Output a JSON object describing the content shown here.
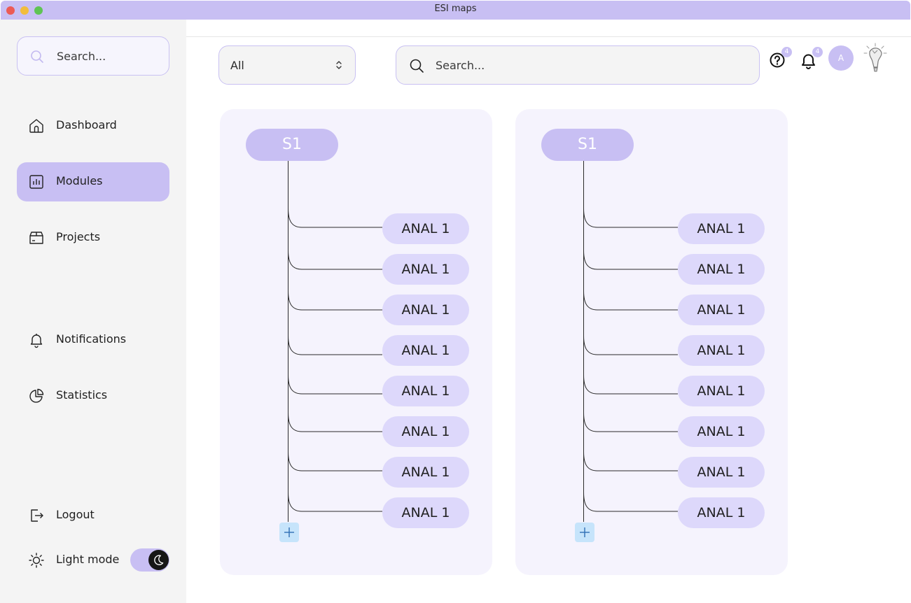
{
  "window": {
    "title": "ESI maps"
  },
  "sidebar": {
    "search_placeholder": "Search...",
    "items": [
      {
        "label": "Dashboard",
        "icon": "home-icon",
        "active": false
      },
      {
        "label": "Modules",
        "icon": "chart-icon",
        "active": true
      },
      {
        "label": "Projects",
        "icon": "box-icon",
        "active": false
      },
      {
        "label": "Notifications",
        "icon": "bell-icon",
        "active": false
      },
      {
        "label": "Statistics",
        "icon": "pie-chart-icon",
        "active": false
      },
      {
        "label": "Logout",
        "icon": "logout-icon",
        "active": false
      },
      {
        "label": "Light mode",
        "icon": "sun-icon",
        "active": false
      }
    ],
    "theme_toggle": {
      "state": "dark",
      "icon": "moon-icon"
    }
  },
  "topbar": {
    "filter_value": "All",
    "search_placeholder": "Search...",
    "help_badge": "4",
    "notifications_badge": "4",
    "avatar_initial": "A"
  },
  "maps": [
    {
      "root": "S1",
      "children": [
        "ANAL 1",
        "ANAL 1",
        "ANAL 1",
        "ANAL 1",
        "ANAL 1",
        "ANAL 1",
        "ANAL 1",
        "ANAL 1"
      ],
      "add_icon": "plus-icon"
    },
    {
      "root": "S1",
      "children": [
        "ANAL 1",
        "ANAL 1",
        "ANAL 1",
        "ANAL 1",
        "ANAL 1",
        "ANAL 1",
        "ANAL 1",
        "ANAL 1"
      ],
      "add_icon": "plus-icon"
    }
  ],
  "colors": {
    "accent": "#c8bff3",
    "leaf": "#ddd8fb",
    "card_bg": "#f5f3fd",
    "sidebar_bg": "#f4f4f4",
    "add_button": "#c6e4fb"
  }
}
